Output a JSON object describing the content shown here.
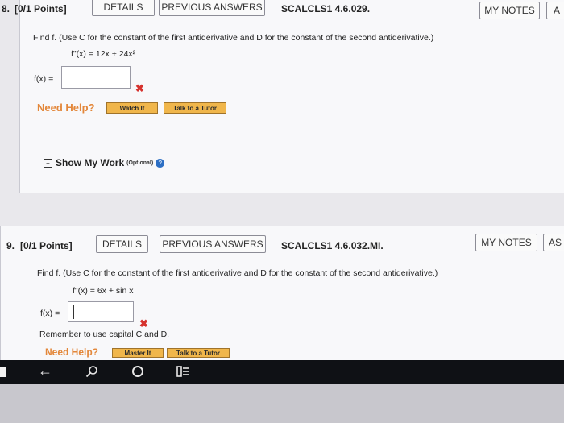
{
  "q8": {
    "number": "8.",
    "points": "[0/1 Points]",
    "details_label": "DETAILS",
    "previous_label": "PREVIOUS ANSWERS",
    "code": "SCALCLS1 4.6.029.",
    "notes_label": "MY NOTES",
    "ask_label": "A",
    "prompt": "Find f. (Use C for the constant of the first antiderivative and D for the constant of the second antiderivative.)",
    "equation": "f\"(x) = 12x + 24x²",
    "answer_label": "f(x) =",
    "answer_value": "",
    "help_label": "Need Help?",
    "watch_label": "Watch It",
    "tutor_label": "Talk to a Tutor",
    "show_work_label": "Show My Work",
    "optional_label": "(Optional)"
  },
  "q9": {
    "number": "9.",
    "points": "[0/1 Points]",
    "details_label": "DETAILS",
    "previous_label": "PREVIOUS ANSWERS",
    "code": "SCALCLS1 4.6.032.MI.",
    "notes_label": "MY NOTES",
    "ask_label": "AS",
    "prompt": "Find f. (Use C for the constant of the first antiderivative and D for the constant of the second antiderivative.)",
    "equation": "f\"(x) = 6x + sin x",
    "answer_label": "f(x) =",
    "answer_value": "",
    "remember": "Remember to use capital C and D.",
    "help_label": "Need Help?",
    "master_label": "Master It",
    "tutor_label": "Talk to a Tutor"
  },
  "icons": {
    "xmark": "✖",
    "back": "←",
    "search": "⌕",
    "home": "○",
    "menu": "≡"
  },
  "colors": {
    "help": "#e3873a",
    "button": "#f0b64b",
    "xmark": "#d6322e"
  }
}
